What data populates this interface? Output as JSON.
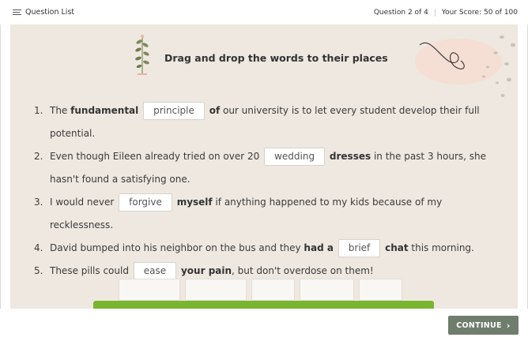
{
  "header": {
    "question_list_label": "Question List",
    "question_progress": "Question 2 of 4",
    "score": "Your Score: 50 of 100"
  },
  "main": {
    "title": "Drag and drop the words to their places",
    "questions": [
      {
        "num": "1.",
        "t1": "The ",
        "b1": "fundamental",
        "chip": "principle",
        "b2": "of",
        "t2": " our university is to let every student develop their full potential."
      },
      {
        "num": "2.",
        "t1": "Even though Eileen already tried on over 20",
        "chip": "wedding",
        "b2": "dresses",
        "t2": " in the past 3 hours, she hasn't found a satisfying one."
      },
      {
        "num": "3.",
        "t1": "I would never",
        "chip": "forgive",
        "b2": "myself",
        "t2": " if anything happened to my kids because of my recklessness."
      },
      {
        "num": "4.",
        "t1": "David bumped into his neighbor on the bus and they ",
        "b1": "had a",
        "chip": "brief",
        "b2": "chat",
        "t2": " this morning."
      },
      {
        "num": "5.",
        "t1": "These pills could",
        "chip": "ease",
        "b2": "your pain",
        "t2": ", but don't overdose on them!"
      }
    ]
  },
  "footer": {
    "continue_label": "CONTINUE"
  },
  "colors": {
    "background": "#efe8e0",
    "continue_button": "#6f7d6c",
    "progress_bar": "#79b52d"
  },
  "icons": [
    "list-icon",
    "plant-icon",
    "chevron-right-icon"
  ]
}
